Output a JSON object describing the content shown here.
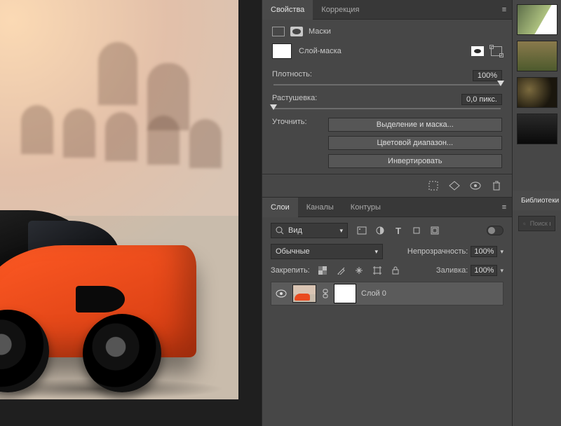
{
  "properties_panel": {
    "tabs": {
      "properties": "Свойства",
      "adjustments": "Коррекция"
    },
    "masks_title": "Маски",
    "mask_type": "Слой-маска",
    "density": {
      "label": "Плотность:",
      "value": "100%",
      "pos": 100
    },
    "feather": {
      "label": "Растушевка:",
      "value": "0,0 пикс.",
      "pos": 0
    },
    "refine_label": "Уточнить:",
    "buttons": {
      "select_and_mask": "Выделение и маска...",
      "color_range": "Цветовой диапазон...",
      "invert": "Инвертировать"
    }
  },
  "layers_panel": {
    "tabs": {
      "layers": "Слои",
      "channels": "Каналы",
      "paths": "Контуры"
    },
    "filter_kind": "Вид",
    "blend_mode": "Обычные",
    "opacity_label": "Непрозрачность:",
    "opacity_value": "100%",
    "lock_label": "Закрепить:",
    "fill_label": "Заливка:",
    "fill_value": "100%",
    "layer_name": "Слой 0"
  },
  "libraries": {
    "tab": "Библиотеки",
    "search_placeholder": "Поиск в Adobe Stock"
  }
}
